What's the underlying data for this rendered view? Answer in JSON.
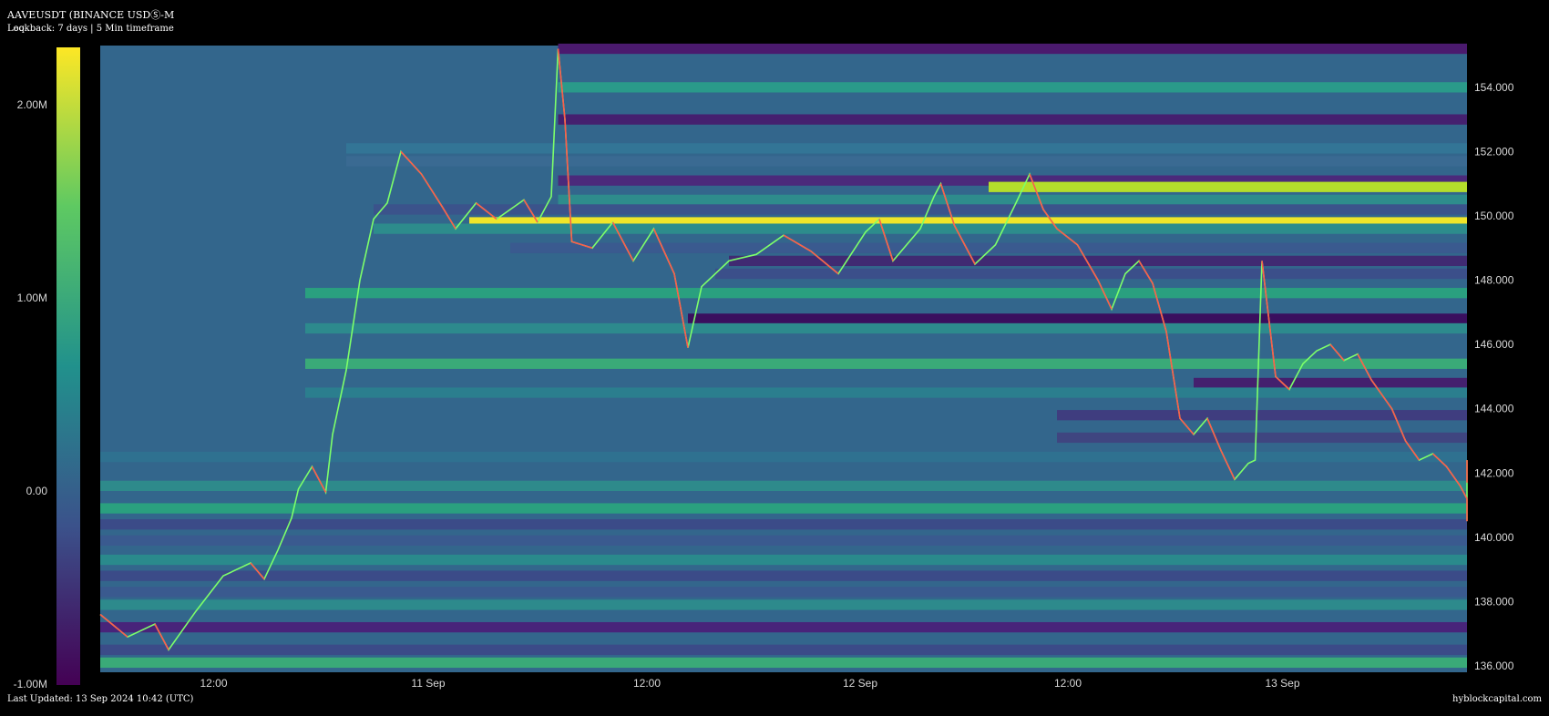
{
  "header": {
    "title": "AAVEUSDT (BINANCE USDⓈ-M",
    "subtitle_overlap": "Leq",
    "subtitle": "Lookback: 7 days | 5 Min timeframe"
  },
  "footer": {
    "last_updated": "Last Updated: 13 Sep 2024 10:42 (UTC)",
    "brand": "hyblockcapital.com"
  },
  "colorbar": {
    "labels": [
      "2.00M",
      "1.00M",
      "0.00",
      "-1.00M"
    ],
    "values": [
      2000000,
      1000000,
      0,
      -1000000
    ],
    "min": -1000000,
    "max": 2300000,
    "stops": [
      "#440154",
      "#3b528b",
      "#21918c",
      "#5ec962",
      "#fde725"
    ]
  },
  "chart_data": {
    "type": "heatmap",
    "ylim": [
      135.8,
      155.3
    ],
    "y_ticks": [
      136,
      138,
      140,
      142,
      144,
      146,
      148,
      150,
      152,
      154
    ],
    "y_tick_labels": [
      "136.000",
      "138.000",
      "140.000",
      "142.000",
      "144.000",
      "146.000",
      "148.000",
      "150.000",
      "152.000",
      "154.000"
    ],
    "x_tick_labels": [
      "12:00",
      "11 Sep",
      "12:00",
      "12 Sep",
      "12:00",
      "13 Sep"
    ],
    "x_tick_pos": [
      0.083,
      0.24,
      0.4,
      0.556,
      0.708,
      0.865
    ],
    "background_color": "#33668c",
    "levels": [
      {
        "price": 155.2,
        "start": 0.335,
        "color": "#4b1a6e",
        "value": -900000
      },
      {
        "price": 154.0,
        "start": 0.335,
        "color": "#2a9a8a",
        "value": 850000
      },
      {
        "price": 153.0,
        "start": 0.335,
        "color": "#45206f",
        "value": -800000
      },
      {
        "price": 152.1,
        "start": 0.18,
        "color": "#337596",
        "value": 150000
      },
      {
        "price": 151.7,
        "start": 0.18,
        "color": "#3a6a92",
        "value": 60000
      },
      {
        "price": 151.1,
        "start": 0.335,
        "color": "#4b2a7b",
        "value": -700000
      },
      {
        "price": 150.9,
        "start": 0.65,
        "color": "#b4dd2b",
        "value": 2000000
      },
      {
        "price": 150.5,
        "start": 0.335,
        "color": "#2e8c8c",
        "value": 600000
      },
      {
        "price": 150.2,
        "start": 0.2,
        "color": "#3b538b",
        "value": -100000
      },
      {
        "price": 149.8,
        "start": 0.27,
        "color": "#f0e529",
        "value": 2250000
      },
      {
        "price": 149.6,
        "start": 0.2,
        "color": "#2d8c8c",
        "value": 550000
      },
      {
        "price": 149.0,
        "start": 0.3,
        "color": "#3a5a8f",
        "value": -150000
      },
      {
        "price": 148.6,
        "start": 0.46,
        "color": "#402a72",
        "value": -600000
      },
      {
        "price": 148.2,
        "start": 0.45,
        "color": "#3b4f8a",
        "value": -300000
      },
      {
        "price": 147.6,
        "start": 0.15,
        "color": "#2aa07f",
        "value": 900000
      },
      {
        "price": 146.8,
        "start": 0.43,
        "color": "#3a0f5e",
        "value": -950000
      },
      {
        "price": 146.5,
        "start": 0.15,
        "color": "#2d8a8d",
        "value": 500000
      },
      {
        "price": 145.4,
        "start": 0.15,
        "color": "#3aaa78",
        "value": 1100000
      },
      {
        "price": 144.8,
        "start": 0.8,
        "color": "#44206e",
        "value": -800000
      },
      {
        "price": 144.5,
        "start": 0.15,
        "color": "#2b7e8e",
        "value": 400000
      },
      {
        "price": 143.8,
        "start": 0.7,
        "color": "#3f3d7f",
        "value": -500000
      },
      {
        "price": 143.1,
        "start": 0.7,
        "color": "#3f4580",
        "value": -400000
      },
      {
        "price": 142.5,
        "start": 0.0,
        "color": "#2f7190",
        "value": 200000
      },
      {
        "price": 141.6,
        "start": 0.0,
        "color": "#2e8a8b",
        "value": 550000
      },
      {
        "price": 140.9,
        "start": 0.0,
        "color": "#2aa07f",
        "value": 950000
      },
      {
        "price": 140.4,
        "start": 0.0,
        "color": "#3b4b88",
        "value": -350000
      },
      {
        "price": 139.9,
        "start": 0.0,
        "color": "#3a5a8f",
        "value": -200000
      },
      {
        "price": 139.3,
        "start": 0.0,
        "color": "#2a8a8c",
        "value": 500000
      },
      {
        "price": 138.8,
        "start": 0.0,
        "color": "#3b4b88",
        "value": -300000
      },
      {
        "price": 138.3,
        "start": 0.0,
        "color": "#3a5a8f",
        "value": -150000
      },
      {
        "price": 137.9,
        "start": 0.0,
        "color": "#2d8a8c",
        "value": 450000
      },
      {
        "price": 137.2,
        "start": 0.0,
        "color": "#48247a",
        "value": -750000
      },
      {
        "price": 136.5,
        "start": 0.0,
        "color": "#3b4b88",
        "value": -300000
      },
      {
        "price": 136.1,
        "start": 0.0,
        "color": "#3aaa78",
        "value": 1100000
      }
    ],
    "price_path": [
      [
        0.0,
        137.6
      ],
      [
        0.02,
        136.9
      ],
      [
        0.04,
        137.3
      ],
      [
        0.05,
        136.5
      ],
      [
        0.07,
        137.7
      ],
      [
        0.09,
        138.8
      ],
      [
        0.11,
        139.2
      ],
      [
        0.12,
        138.7
      ],
      [
        0.13,
        139.6
      ],
      [
        0.14,
        140.6
      ],
      [
        0.145,
        141.5
      ],
      [
        0.155,
        142.2
      ],
      [
        0.165,
        141.4
      ],
      [
        0.17,
        143.2
      ],
      [
        0.18,
        145.2
      ],
      [
        0.19,
        148.0
      ],
      [
        0.2,
        149.9
      ],
      [
        0.21,
        150.4
      ],
      [
        0.22,
        152.0
      ],
      [
        0.235,
        151.3
      ],
      [
        0.25,
        150.3
      ],
      [
        0.26,
        149.6
      ],
      [
        0.275,
        150.4
      ],
      [
        0.29,
        149.9
      ],
      [
        0.31,
        150.5
      ],
      [
        0.32,
        149.8
      ],
      [
        0.33,
        150.6
      ],
      [
        0.335,
        155.2
      ],
      [
        0.34,
        153.0
      ],
      [
        0.345,
        149.2
      ],
      [
        0.36,
        149.0
      ],
      [
        0.375,
        149.8
      ],
      [
        0.39,
        148.6
      ],
      [
        0.405,
        149.6
      ],
      [
        0.42,
        148.2
      ],
      [
        0.43,
        145.9
      ],
      [
        0.44,
        147.8
      ],
      [
        0.46,
        148.6
      ],
      [
        0.48,
        148.8
      ],
      [
        0.5,
        149.4
      ],
      [
        0.52,
        148.9
      ],
      [
        0.54,
        148.2
      ],
      [
        0.56,
        149.5
      ],
      [
        0.57,
        149.9
      ],
      [
        0.58,
        148.6
      ],
      [
        0.6,
        149.6
      ],
      [
        0.61,
        150.6
      ],
      [
        0.615,
        151.0
      ],
      [
        0.625,
        149.7
      ],
      [
        0.64,
        148.5
      ],
      [
        0.655,
        149.1
      ],
      [
        0.67,
        150.4
      ],
      [
        0.68,
        151.3
      ],
      [
        0.69,
        150.2
      ],
      [
        0.7,
        149.6
      ],
      [
        0.715,
        149.1
      ],
      [
        0.73,
        148.0
      ],
      [
        0.74,
        147.1
      ],
      [
        0.75,
        148.2
      ],
      [
        0.76,
        148.6
      ],
      [
        0.77,
        147.9
      ],
      [
        0.78,
        146.4
      ],
      [
        0.79,
        143.7
      ],
      [
        0.8,
        143.2
      ],
      [
        0.81,
        143.7
      ],
      [
        0.82,
        142.7
      ],
      [
        0.83,
        141.8
      ],
      [
        0.84,
        142.3
      ],
      [
        0.845,
        142.4
      ],
      [
        0.85,
        148.6
      ],
      [
        0.86,
        145.0
      ],
      [
        0.87,
        144.6
      ],
      [
        0.88,
        145.4
      ],
      [
        0.89,
        145.8
      ],
      [
        0.9,
        146.0
      ],
      [
        0.91,
        145.5
      ],
      [
        0.92,
        145.7
      ],
      [
        0.93,
        144.9
      ],
      [
        0.945,
        144.0
      ],
      [
        0.955,
        143.0
      ],
      [
        0.965,
        142.4
      ],
      [
        0.975,
        142.6
      ],
      [
        0.985,
        142.2
      ],
      [
        0.995,
        141.6
      ],
      [
        1.005,
        141.2
      ],
      [
        1.02,
        140.6
      ],
      [
        1.03,
        140.5
      ],
      [
        1.04,
        141.0
      ],
      [
        1.05,
        142.4
      ],
      [
        1.055,
        141.7
      ]
    ]
  }
}
